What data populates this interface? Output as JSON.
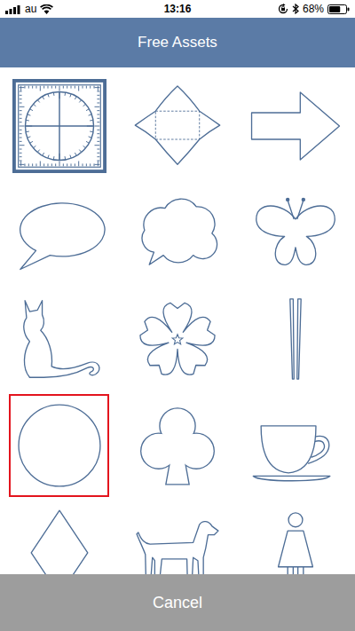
{
  "status_bar": {
    "carrier": "au",
    "signal": {
      "level": 1
    },
    "time": "13:16",
    "battery": {
      "reading": "68%",
      "level": 0.68
    }
  },
  "nav_bar": {
    "title": "Free Assets"
  },
  "assets": [
    {
      "kind": "protractor",
      "selected": false
    },
    {
      "kind": "envelope",
      "selected": false
    },
    {
      "kind": "arrow",
      "selected": false
    },
    {
      "kind": "speech-bubble",
      "selected": false
    },
    {
      "kind": "cloud-bubble",
      "selected": false
    },
    {
      "kind": "butterfly",
      "selected": false
    },
    {
      "kind": "cat",
      "selected": false
    },
    {
      "kind": "sakura",
      "selected": false
    },
    {
      "kind": "chopsticks",
      "selected": false
    },
    {
      "kind": "circle",
      "selected": true
    },
    {
      "kind": "club",
      "selected": false
    },
    {
      "kind": "cup",
      "selected": false
    },
    {
      "kind": "diamond",
      "selected": false
    },
    {
      "kind": "dog",
      "selected": false
    },
    {
      "kind": "woman",
      "selected": false
    }
  ],
  "buttons": [
    "Cancel"
  ]
}
